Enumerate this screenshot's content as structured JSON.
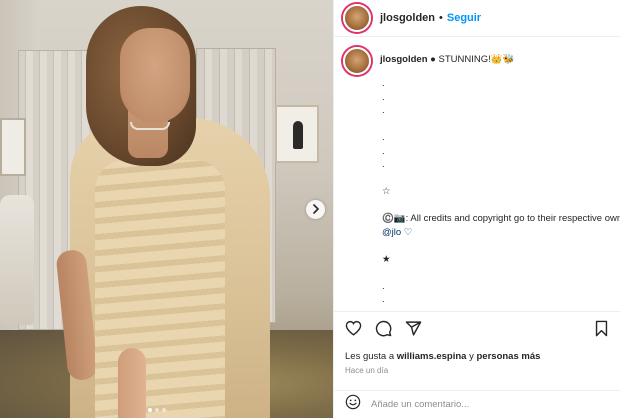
{
  "post": {
    "media_count_dots": 3,
    "active_dot": 1
  },
  "header": {
    "username": "jlosgolden",
    "separator": "•",
    "follow_label": "Seguir"
  },
  "caption": {
    "username": "jlosgolden",
    "text": "● STUNNING!👑🐝",
    "lines": [
      ".",
      ".",
      ".",
      "",
      ".",
      ".",
      ".",
      "",
      "☆",
      "",
      "©️📷: All credits and copyright go to their respective owners",
      "@jlo ♡",
      "",
      "★",
      "",
      ".",
      ".",
      "."
    ]
  },
  "actions": {
    "like_icon": "heart-icon",
    "comment_icon": "comment-icon",
    "share_icon": "share-icon",
    "save_icon": "bookmark-icon"
  },
  "likes": {
    "prefix": "Les gusta a ",
    "user": "williams.espina",
    "middle": " y ",
    "others": "personas más"
  },
  "time": "Hace un día",
  "comment_box": {
    "placeholder": "Añade un comentario..."
  },
  "colors": {
    "accent_blue": "#0095f6",
    "story_ring": "#e1306c",
    "muted_text": "#8e8e8e"
  }
}
